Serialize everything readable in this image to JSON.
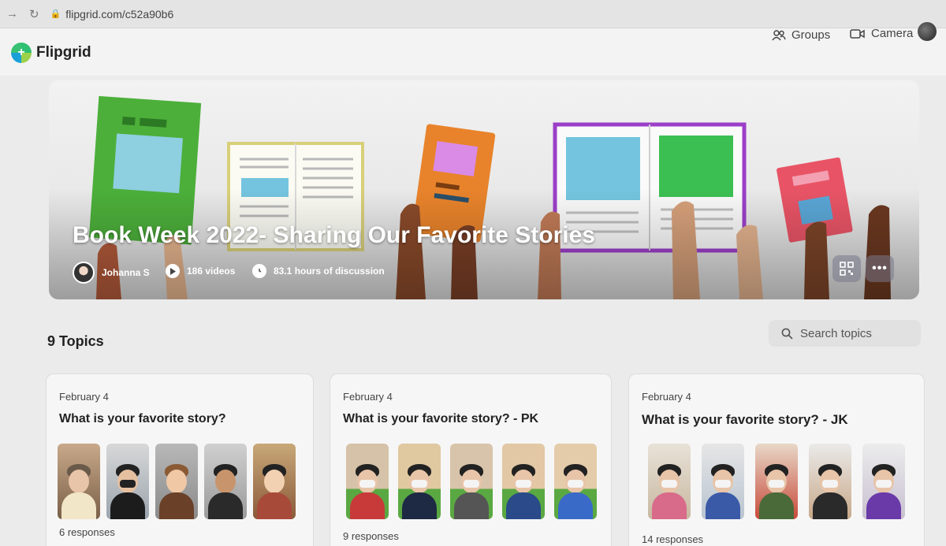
{
  "browser": {
    "url": "flipgrid.com/c52a90b6"
  },
  "header": {
    "logo_text": "Flipgrid",
    "groups_label": "Groups",
    "camera_label": "Camera"
  },
  "banner": {
    "title": "Book Week 2022- Sharing Our Favorite Stories",
    "owner": "Johanna S",
    "videos": "186 videos",
    "discussion": "83.1 hours of discussion",
    "qr_icon": "qr-code-icon",
    "more_icon": "more-dots-icon"
  },
  "topics": {
    "count_label": "9 Topics",
    "search_placeholder": "Search topics",
    "cards": [
      {
        "date": "February 4",
        "title": "What is your favorite story?",
        "responses": "6 responses"
      },
      {
        "date": "February 4",
        "title": "What is your favorite story? - PK",
        "responses": "9 responses"
      },
      {
        "date": "February 4",
        "title": "What is your favorite story? - JK",
        "responses": "14 responses"
      }
    ]
  },
  "colors": {
    "accent_green": "#2fbf71",
    "book_green": "#4caf3a",
    "book_orange": "#e8832b",
    "book_purple": "#9b3fc8",
    "book_red": "#e85466",
    "page_blue": "#74c4df"
  }
}
